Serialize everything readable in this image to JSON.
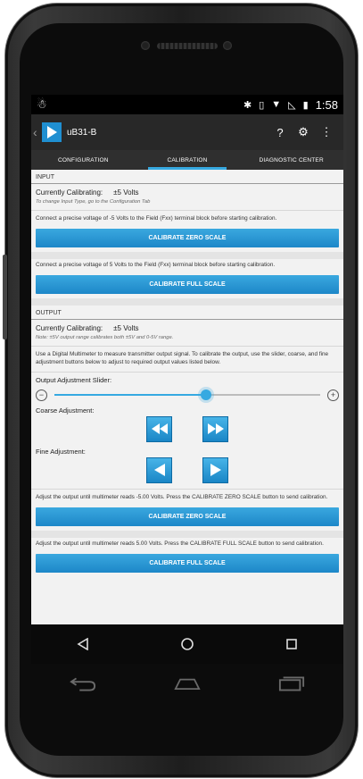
{
  "status_bar": {
    "time": "1:58"
  },
  "app": {
    "title": "uB31-B"
  },
  "action_bar": {
    "help_label": "?"
  },
  "tabs": [
    {
      "label": "CONFIGURATION",
      "active": false
    },
    {
      "label": "CALIBRATION",
      "active": true
    },
    {
      "label": "DIAGNOSTIC CENTER",
      "active": false
    }
  ],
  "input": {
    "header": "INPUT",
    "calibrating_label": "Currently Calibrating:",
    "calibrating_value": "±5 Volts",
    "note": "To change Input Type, go to the Configuration Tab",
    "zero_instruction": "Connect a precise voltage of -5 Volts to the Field (Fxx) terminal block before starting calibration.",
    "zero_button": "CALIBRATE ZERO SCALE",
    "full_instruction": "Connect a precise voltage of 5 Volts to the Field (Fxx) terminal block before starting calibration.",
    "full_button": "CALIBRATE FULL SCALE"
  },
  "output": {
    "header": "OUTPUT",
    "calibrating_label": "Currently Calibrating:",
    "calibrating_value": "±5 Volts",
    "note": "Note: ±5V output range calibrates both ±5V and 0-5V range.",
    "instruction": "Use a Digital Multimeter to measure transmitter output signal. To calibrate the output, use the slider, coarse, and fine adjustment buttons below to adjust to required output values listed below.",
    "slider_label": "Output Adjustment Slider:",
    "slider_value": 0.57,
    "coarse_label": "Coarse Adjustment:",
    "fine_label": "Fine Adjustment:",
    "zero_instruction": "Adjust the output until multimeter reads -5.00 Volts. Press the CALIBRATE ZERO SCALE button to send calibration.",
    "zero_button": "CALIBRATE ZERO SCALE",
    "full_instruction": "Adjust the output until multimeter reads 5.00 Volts. Press the CALIBRATE FULL SCALE button to send calibration.",
    "full_button": "CALIBRATE FULL SCALE"
  },
  "colors": {
    "accent": "#36a9e1",
    "button": "#1d87c8",
    "actionbar": "#282828"
  }
}
